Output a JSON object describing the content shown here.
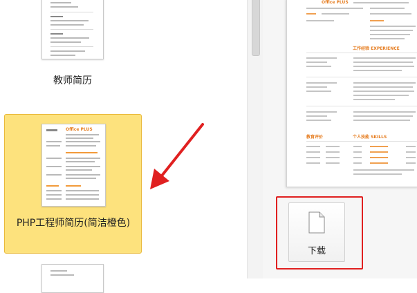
{
  "template_list": {
    "items": [
      {
        "caption": "教师简历",
        "selected": false
      },
      {
        "caption": "PHP工程师简历(简洁橙色)",
        "selected": true
      },
      {
        "caption": "",
        "selected": false
      }
    ],
    "selected_thumb_title": "Office PLUS"
  },
  "preview": {
    "name": "Office PLUS",
    "section_experience": "工作经验 EXPERIENCE",
    "section_education": "教育评价",
    "section_skills": "个人技能 SKILLS"
  },
  "download": {
    "label": "下载"
  },
  "colors": {
    "accent": "#e67e22",
    "selection": "#fde27d",
    "annotation": "#e02020"
  }
}
